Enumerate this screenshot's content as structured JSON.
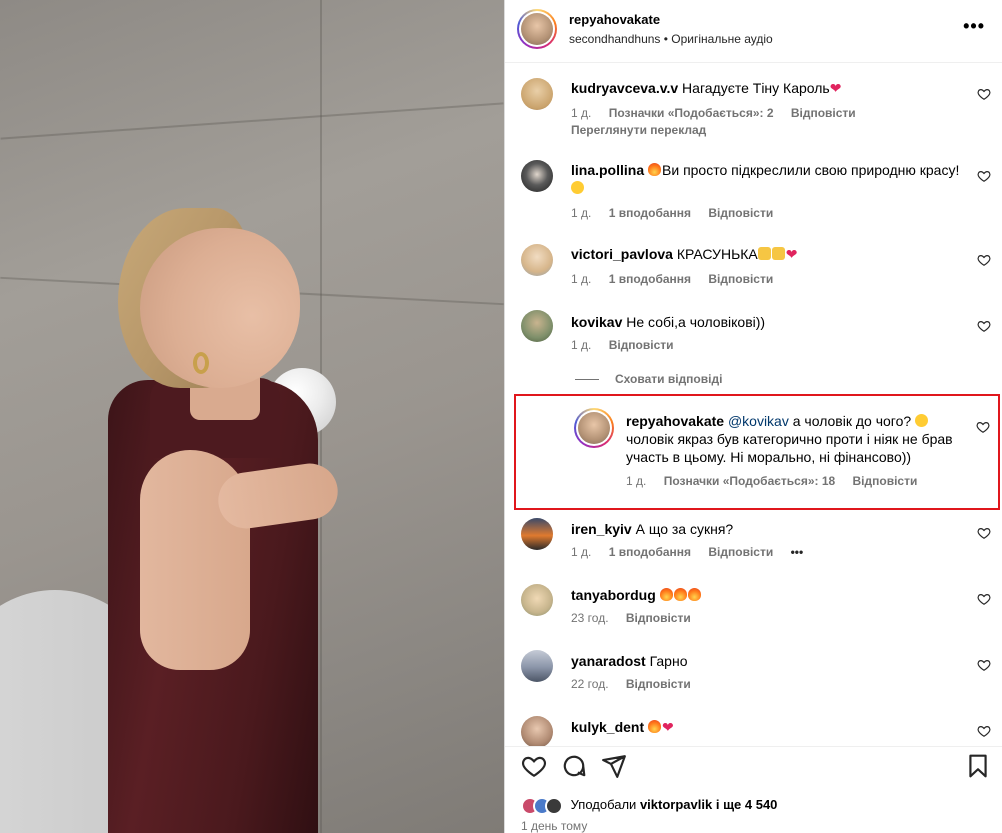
{
  "post": {
    "author": "repyahovakate",
    "audio": "secondhandhuns • Оригінальне аудіо"
  },
  "comments": [
    {
      "user": "kudryavceva.v.v",
      "text": "Нагадуєте Тіну Кароль",
      "emojis": [
        "heart"
      ],
      "time": "1 д.",
      "likes": "Позначки «Подобається»: 2",
      "reply": "Відповісти",
      "extra": "Переглянути переклад",
      "avatar_color": "#c9a26b"
    },
    {
      "user": "lina.pollina",
      "text_before": "",
      "text": "Ви просто підкреслили свою природню красу!",
      "emojis_before": [
        "fire"
      ],
      "emojis_after": [
        "face"
      ],
      "time": "1 д.",
      "likes": "1 вподобання",
      "reply": "Відповісти",
      "avatar_color": "#3a3a3a"
    },
    {
      "user": "victori_pavlova",
      "text": "КРАСУНЬКА",
      "emojis": [
        "thumb",
        "thumb",
        "heart"
      ],
      "time": "1 д.",
      "likes": "1 вподобання",
      "reply": "Відповісти",
      "avatar_color": "#d6b58a"
    },
    {
      "user": "kovikav",
      "text": "Не собі,а чоловікові))",
      "time": "1 д.",
      "reply": "Відповісти",
      "avatar_color": "#7e8f6a"
    },
    {
      "user": "iren_kyiv",
      "text": "А що за сукня?",
      "time": "1 д.",
      "likes": "1 вподобання",
      "reply": "Відповісти",
      "more": "•••",
      "avatar_color": "#e07a2e"
    },
    {
      "user": "tanyabordug",
      "text": "",
      "emojis": [
        "fire",
        "fire",
        "fire"
      ],
      "time": "23 год.",
      "reply": "Відповісти",
      "avatar_color": "#c6b48c"
    },
    {
      "user": "yanaradost",
      "text": "Гарно",
      "time": "22 год.",
      "reply": "Відповісти",
      "avatar_color": "#8a94a8"
    },
    {
      "user": "kulyk_dent",
      "text": "",
      "emojis": [
        "fire",
        "heart"
      ],
      "avatar_color": "#b08a72"
    }
  ],
  "hide_replies": "Сховати відповіді",
  "reply": {
    "user": "repyahovakate",
    "mention": "@kovikav",
    "text": "а чоловік до чого?",
    "text2": "чоловік якраз був категорично проти і ніяк не брав участь в цьому. Ні морально, ні фінансово))",
    "time": "1 д.",
    "likes": "Позначки «Подобається»: 18",
    "reply": "Відповісти"
  },
  "footer": {
    "liked_prefix": "Уподобали",
    "liked_user": "viktorpavlik",
    "liked_suffix": "і ще 4 540",
    "time": "1 день тому"
  },
  "colors": {
    "highlight": "#e0161c",
    "meta": "#737373",
    "heart": "#e0245e"
  }
}
